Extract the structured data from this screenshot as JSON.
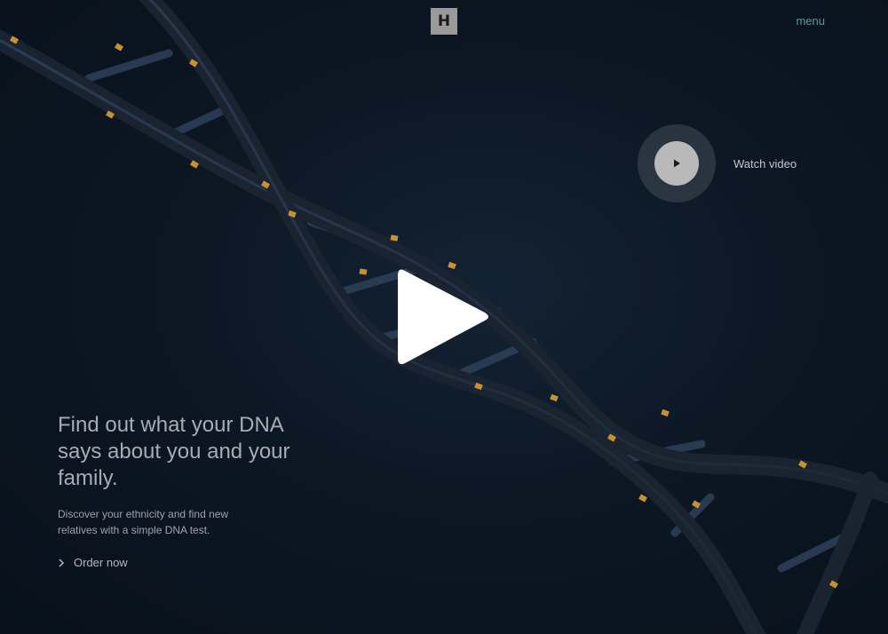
{
  "header": {
    "logo_letter": "H",
    "menu_label": "menu"
  },
  "video": {
    "watch_label": "Watch video"
  },
  "hero": {
    "headline": "Find out what your DNA says about you and your family.",
    "subtext": "Discover your ethnicity and find new relatives with a simple DNA test.",
    "cta_label": "Order now"
  },
  "colors": {
    "background": "#0c1724",
    "accent_menu": "#5a9a93",
    "strand": "#1b2330",
    "highlight": "#c9912e"
  },
  "icons": [
    "logo-mark",
    "play-icon",
    "chevron-right-icon",
    "dna-helix-illustration"
  ]
}
